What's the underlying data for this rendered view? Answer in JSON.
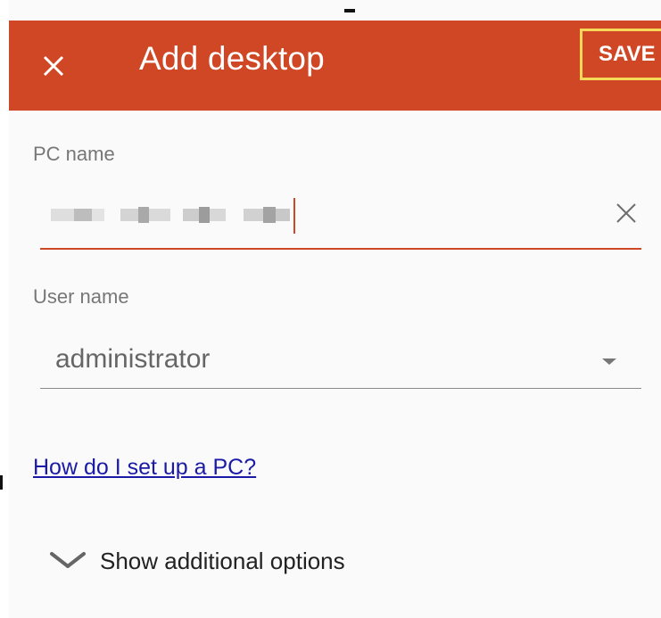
{
  "appbar": {
    "title": "Add desktop",
    "save_label": "SAVE",
    "close_icon": "close-icon",
    "color": "#cf4724",
    "save_highlight_color": "#f7d95a"
  },
  "form": {
    "pc_name": {
      "label": "PC name",
      "value_state": "obscured (pixelated)",
      "clear_icon": "clear-icon"
    },
    "user_name": {
      "label": "User name",
      "value": "administrator",
      "dropdown_icon": "dropdown-arrow-icon"
    }
  },
  "help_link": "How do I set up a PC?",
  "additional_options": {
    "label": "Show additional options",
    "icon": "chevron-down-icon"
  }
}
